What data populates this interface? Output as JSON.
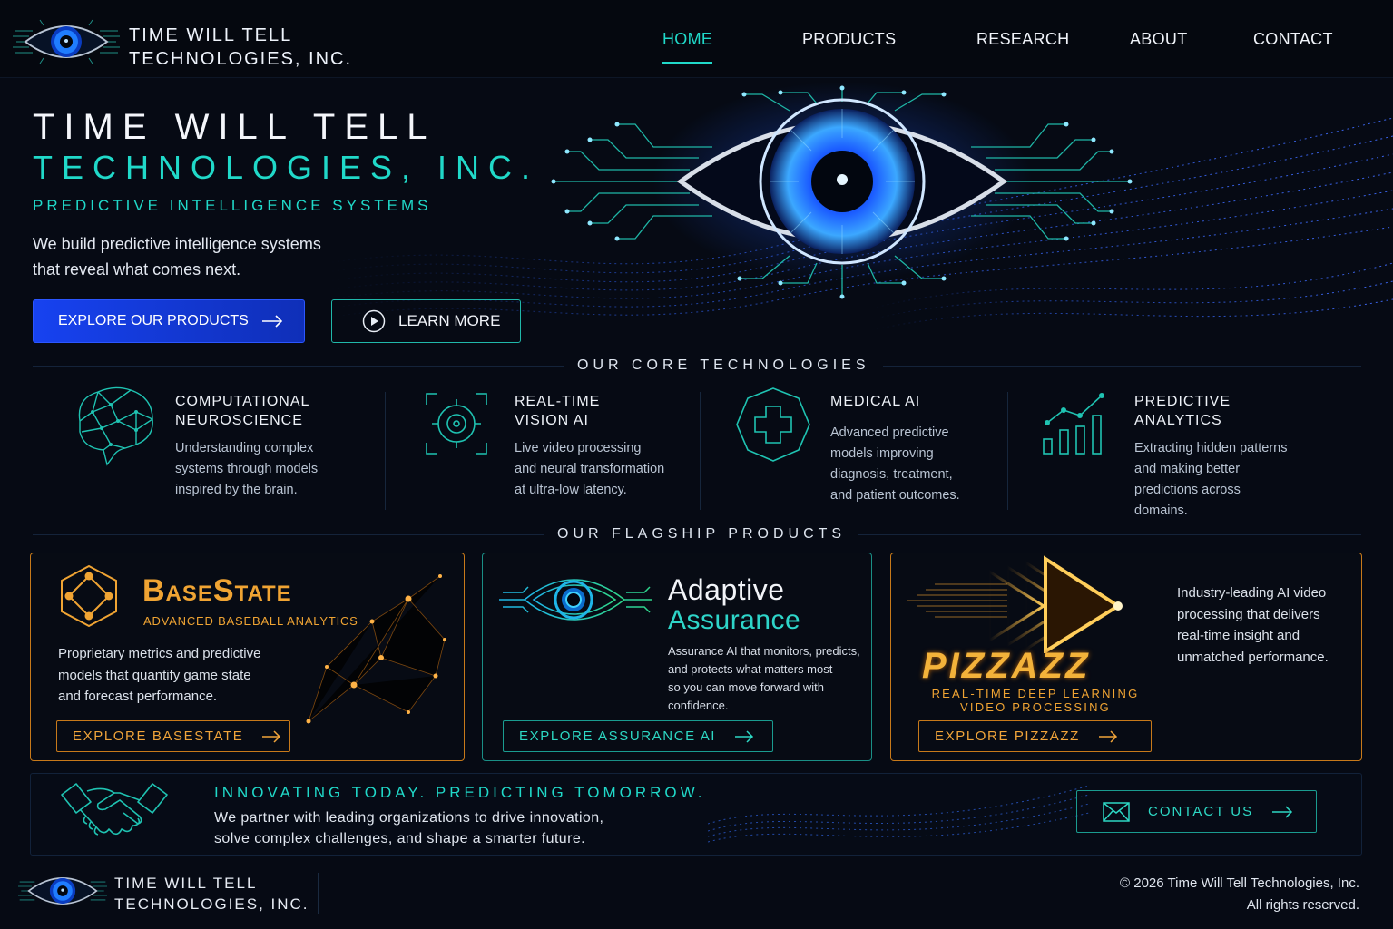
{
  "header": {
    "brand_line1": "TIME WILL TELL",
    "brand_line2": "TECHNOLOGIES, INC.",
    "nav": [
      "HOME",
      "PRODUCTS",
      "RESEARCH",
      "ABOUT",
      "CONTACT"
    ],
    "active_nav": "HOME"
  },
  "hero": {
    "title_line1": "TIME WILL TELL",
    "title_line2": "TECHNOLOGIES, INC.",
    "tagline": "PREDICTIVE INTELLIGENCE SYSTEMS",
    "description_line1": "We build predictive intelligence systems",
    "description_line2": "that reveal what comes next.",
    "primary_button": "EXPLORE OUR PRODUCTS",
    "secondary_button": "LEARN MORE"
  },
  "core": {
    "section_title": "OUR CORE TECHNOLOGIES",
    "items": [
      {
        "title_line1": "COMPUTATIONAL",
        "title_line2": "NEUROSCIENCE",
        "desc": [
          "Understanding complex",
          "systems through models",
          "inspired by the brain."
        ],
        "icon": "brain-icon"
      },
      {
        "title_line1": "REAL-TIME",
        "title_line2": "VISION AI",
        "desc": [
          "Live video processing",
          "and neural transformation",
          "at ultra-low latency."
        ],
        "icon": "target-icon"
      },
      {
        "title_line1": "MEDICAL AI",
        "title_line2": "",
        "desc": [
          "Advanced predictive",
          "models improving",
          "diagnosis, treatment,",
          "and patient outcomes."
        ],
        "icon": "medical-cross-icon"
      },
      {
        "title_line1": "PREDICTIVE",
        "title_line2": "ANALYTICS",
        "desc": [
          "Extracting hidden patterns",
          "and making better",
          "predictions across",
          "domains."
        ],
        "icon": "bar-chart-icon"
      }
    ]
  },
  "products": {
    "section_title": "OUR FLAGSHIP PRODUCTS",
    "basestate": {
      "logo": "BaseState",
      "subtitle": "ADVANCED BASEBALL ANALYTICS",
      "desc": [
        "Proprietary metrics and predictive",
        "models that quantify game state",
        "and forecast performance."
      ],
      "button": "EXPLORE BASESTATE",
      "color": "#f0a433"
    },
    "adaptive": {
      "logo_line1": "Adaptive",
      "logo_line2": "Assurance",
      "desc": [
        "Assurance AI that monitors, predicts,",
        "and protects what matters most—",
        "so you can move forward with",
        "confidence."
      ],
      "button": "EXPLORE ASSURANCE AI",
      "color": "#2ed5c9"
    },
    "pizzazz": {
      "logo": "PIZZAZZ",
      "subtitle_line1": "REAL-TIME DEEP LEARNING",
      "subtitle_line2": "VIDEO PROCESSING",
      "desc": [
        "Industry-leading AI video",
        "processing that delivers",
        "real-time insight and",
        "unmatched performance."
      ],
      "button": "EXPLORE PIZZAZZ"
    }
  },
  "band": {
    "title": "INNOVATING TODAY. PREDICTING TOMORROW.",
    "desc_line1": "We partner with leading organizations to drive innovation,",
    "desc_line2": "solve complex challenges, and shape a smarter future.",
    "button": "CONTACT US"
  },
  "footer": {
    "brand_line1": "TIME WILL TELL",
    "brand_line2": "TECHNOLOGIES, INC.",
    "copyright": "© 2026 Time Will Tell Technologies, Inc.",
    "rights": "All rights reserved."
  },
  "colors": {
    "accent": "#20d9c9",
    "primary": "#1742f0",
    "orange": "#f0a433",
    "background": "#060a14"
  }
}
